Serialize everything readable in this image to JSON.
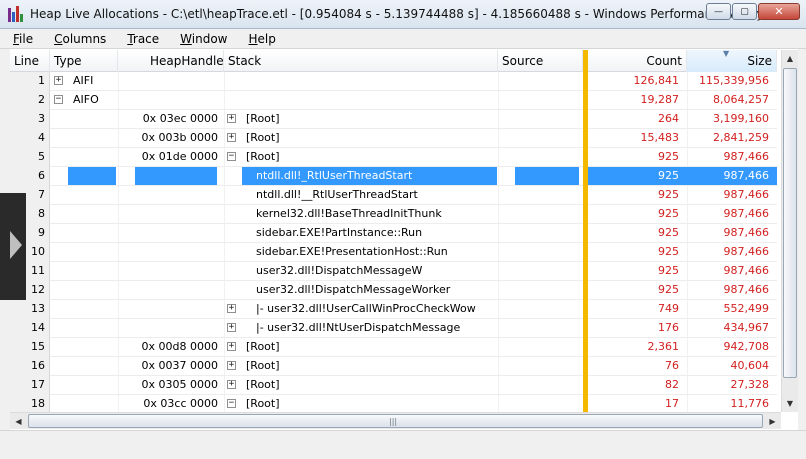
{
  "window": {
    "title": "Heap Live Allocations - C:\\etl\\heapTrace.etl - [0.954084 s - 5.139744488 s] - 4.185660488 s - Windows Performance Analyzer",
    "minimize_glyph": "—",
    "maximize_glyph": "▢",
    "close_glyph": "✕"
  },
  "menu": [
    {
      "first": "F",
      "rest": "ile"
    },
    {
      "first": "C",
      "rest": "olumns"
    },
    {
      "first": "T",
      "rest": "race"
    },
    {
      "first": "W",
      "rest": "indow"
    },
    {
      "first": "H",
      "rest": "elp"
    }
  ],
  "columns": {
    "line": "Line",
    "type": "Type",
    "heap": "HeapHandle",
    "stack": "Stack",
    "source": "Source",
    "count": "Count",
    "size": "Size"
  },
  "rows": [
    {
      "line": "1",
      "type": "AIFI",
      "heap": "",
      "stack": "",
      "count": "126,841",
      "size": "115,339,956"
    },
    {
      "line": "2",
      "type": "AIFO",
      "heap": "",
      "stack": "",
      "count": "19,287",
      "size": "8,064,257"
    },
    {
      "line": "3",
      "type": "",
      "heap": "0x 03ec 0000",
      "stack": "[Root]",
      "count": "264",
      "size": "3,199,160"
    },
    {
      "line": "4",
      "type": "",
      "heap": "0x 003b 0000",
      "stack": "[Root]",
      "count": "15,483",
      "size": "2,841,259"
    },
    {
      "line": "5",
      "type": "",
      "heap": "0x 01de 0000",
      "stack": "[Root]",
      "count": "925",
      "size": "987,466"
    },
    {
      "line": "6",
      "type": "",
      "heap": "",
      "stack": "ntdll.dll!_RtlUserThreadStart",
      "count": "925",
      "size": "987,466"
    },
    {
      "line": "7",
      "type": "",
      "heap": "",
      "stack": "ntdll.dll!__RtlUserThreadStart",
      "count": "925",
      "size": "987,466"
    },
    {
      "line": "8",
      "type": "",
      "heap": "",
      "stack": "kernel32.dll!BaseThreadInitThunk",
      "count": "925",
      "size": "987,466"
    },
    {
      "line": "9",
      "type": "",
      "heap": "",
      "stack": "sidebar.EXE!PartInstance::Run",
      "count": "925",
      "size": "987,466"
    },
    {
      "line": "10",
      "type": "",
      "heap": "",
      "stack": "sidebar.EXE!PresentationHost::Run",
      "count": "925",
      "size": "987,466"
    },
    {
      "line": "11",
      "type": "",
      "heap": "",
      "stack": "user32.dll!DispatchMessageW",
      "count": "925",
      "size": "987,466"
    },
    {
      "line": "12",
      "type": "",
      "heap": "",
      "stack": "user32.dll!DispatchMessageWorker",
      "count": "925",
      "size": "987,466"
    },
    {
      "line": "13",
      "type": "",
      "heap": "",
      "stack": "|- user32.dll!UserCallWinProcCheckWow",
      "count": "749",
      "size": "552,499"
    },
    {
      "line": "14",
      "type": "",
      "heap": "",
      "stack": "|- user32.dll!NtUserDispatchMessage",
      "count": "176",
      "size": "434,967"
    },
    {
      "line": "15",
      "type": "",
      "heap": "0x 00d8 0000",
      "stack": "[Root]",
      "count": "2,361",
      "size": "942,708"
    },
    {
      "line": "16",
      "type": "",
      "heap": "0x 0037 0000",
      "stack": "[Root]",
      "count": "76",
      "size": "40,604"
    },
    {
      "line": "17",
      "type": "",
      "heap": "0x 0305 0000",
      "stack": "[Root]",
      "count": "82",
      "size": "27,328"
    },
    {
      "line": "18",
      "type": "",
      "heap": "0x 03cc 0000",
      "stack": "[Root]",
      "count": "17",
      "size": "11,776"
    }
  ],
  "colors": {
    "selection": "#3399ff",
    "value_text": "#d32020",
    "freeze_bar": "#f5b800"
  }
}
